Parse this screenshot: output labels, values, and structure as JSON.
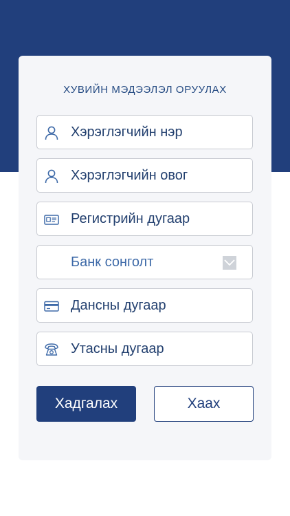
{
  "form": {
    "title": "ХУВИЙН МЭДЭЭЛЭЛ ОРУУЛАХ",
    "fields": [
      {
        "icon": "user-icon",
        "label": "Хэрэглэгчийн нэр"
      },
      {
        "icon": "user-icon",
        "label": "Хэрэглэгчийн овог"
      },
      {
        "icon": "id-card-icon",
        "label": "Регистрийн дугаар"
      },
      {
        "icon": "chevron-down-icon",
        "label": "Банк сонголт"
      },
      {
        "icon": "credit-card-icon",
        "label": "Дансны дугаар"
      },
      {
        "icon": "telephone-icon",
        "label": "Утасны дугаар"
      }
    ],
    "save_label": "Хадгалах",
    "close_label": "Хаах"
  },
  "colors": {
    "primary": "#213f7c",
    "icon_blue": "#3e6aa8",
    "text": "#23406f",
    "card_bg": "#f5f6f9",
    "field_border": "#c7cad1"
  }
}
